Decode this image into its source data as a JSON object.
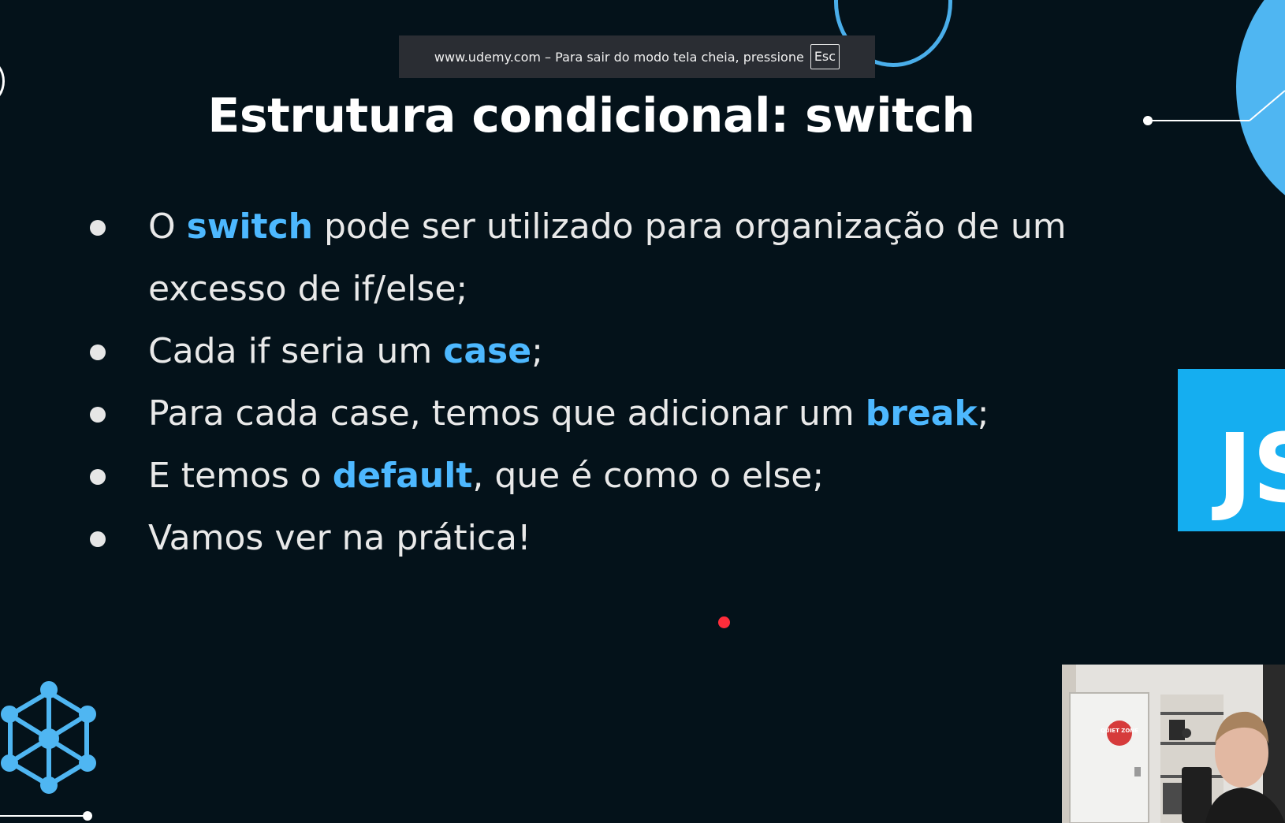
{
  "fullscreen_notice": {
    "message": "www.udemy.com – Para sair do modo tela cheia, pressione",
    "key": "Esc"
  },
  "slide": {
    "title": "Estrutura condicional: switch",
    "bullets": [
      {
        "before": "O ",
        "highlight": "switch",
        "after": " pode ser utilizado para organização de um excesso de if/else;"
      },
      {
        "before": "Cada if seria um ",
        "highlight": "case",
        "after": ";"
      },
      {
        "before": "Para cada case, temos que adicionar um ",
        "highlight": "break",
        "after": ";"
      },
      {
        "before": "E temos o ",
        "highlight": "default",
        "after": ", que é como o else;"
      },
      {
        "before": "Vamos ver na prática!",
        "highlight": "",
        "after": ""
      }
    ],
    "js_logo": "JS",
    "poster_text": "QUIET ZONE"
  },
  "colors": {
    "background": "#04121a",
    "highlight": "#4db8ff",
    "accent_blue": "#15aef0",
    "pointer_red": "#ff2d3b"
  },
  "icons": {
    "network": "network-cube-icon",
    "pointer": "laser-pointer-dot"
  }
}
